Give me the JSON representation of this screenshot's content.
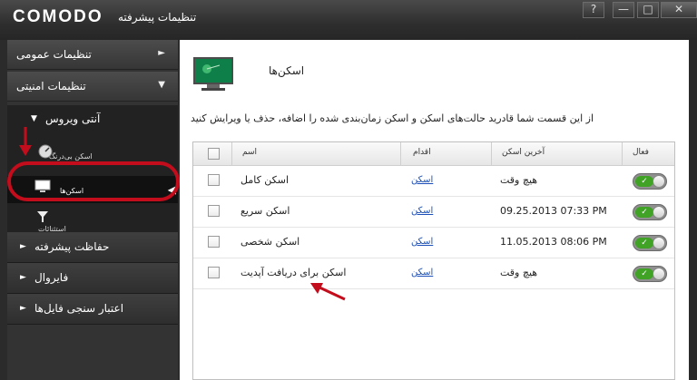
{
  "window": {
    "brand": "COMODO",
    "title": "تنظیمات پیشرفته",
    "help_label": "?",
    "minimize_label": "—",
    "maximize_label": "□",
    "close_label": "✕"
  },
  "sidebar": {
    "general_settings": "تنظیمات عمومی",
    "security_settings": "تنظیمات امنیتی",
    "antivirus": "آنتی ویروس",
    "realtime_scan": "اسکن بی‌درنگ",
    "scans": "اسکن‌ها",
    "exclusions": "استثنائات",
    "advanced_protection": "حفاظت پیشرفته",
    "firewall": "فایروال",
    "file_rating": "اعتبار سنجی فایل‌ها",
    "arrow_right": "►",
    "arrow_down": "▼"
  },
  "main": {
    "title": "اسکن‌ها",
    "description": "از این قسمت شما قادرید حالت‌های اسکن و اسکن زمان‌بندی شده را اضافه، حذف یا ویرایش کنید",
    "columns": {
      "name": "اسم",
      "action": "اقدام",
      "last_scan": "آخرین اسکن",
      "active": "فعال"
    },
    "rows": [
      {
        "name": "اسکن کامل",
        "action": "اسکن",
        "last_scan": "هیچ وقت"
      },
      {
        "name": "اسکن سریع",
        "action": "اسکن",
        "last_scan": "09.25.2013 07:33 PM"
      },
      {
        "name": "اسکن شخصی",
        "action": "اسکن",
        "last_scan": "11.05.2013 08:06 PM"
      },
      {
        "name": "اسکن برای دریافت آپدیت",
        "action": "اسکن",
        "last_scan": "هیچ وقت"
      }
    ],
    "toggle_on": "✓"
  },
  "colors": {
    "annotation_red": "#c40d1c",
    "highlight_yellow": "#f9f07a",
    "toggle_green": "#40a326"
  }
}
